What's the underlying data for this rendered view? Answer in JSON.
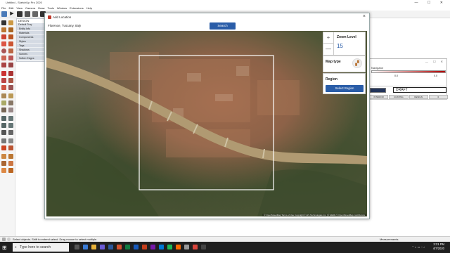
{
  "app": {
    "title": "Untitled - SketchUp Pro 2020",
    "window_controls": "— ☐ ✕"
  },
  "menu": [
    "File",
    "Edit",
    "View",
    "Camera",
    "Draw",
    "Tools",
    "Window",
    "Extensions",
    "Help"
  ],
  "tray": {
    "title": "Default Tray",
    "header_label": "DESIGN",
    "items": [
      "Entity Info",
      "Materials",
      "Components",
      "Styles",
      "Tags",
      "Shadows",
      "Scenes",
      "Soften Edges"
    ]
  },
  "dialog": {
    "title": "Add Location",
    "close": "×",
    "search": {
      "value": "Florence, Tuscany, Italy",
      "button": "Search"
    },
    "zoom": {
      "label": "Zoom Level",
      "value": "15",
      "plus": "+",
      "minus": "—"
    },
    "map_type": {
      "label": "Map type"
    },
    "region": {
      "label": "Region",
      "button": "Select Region"
    },
    "attribution": "© OpenStreetMap  Terms of Use  Copyright © AIS Technologies Inc. (© HERE © OpenStreetMap contributors"
  },
  "right_panel": {
    "title": "Navigator",
    "values": [
      "0.0",
      "0.0"
    ],
    "style_field": "DRAFT",
    "style_tabs": [
      "INTERIOR",
      "COATING",
      "DESIGN",
      "0"
    ],
    "gradient_colors": [
      "#ffffff",
      "#b20000"
    ]
  },
  "status": {
    "message": "Select objects. Shift to extend select. Drag mouse to select multiple.",
    "measurements_label": "Measurements"
  },
  "taskbar": {
    "search_placeholder": "Type here to search",
    "time": "3:31 PM",
    "date": "4/7/2020"
  },
  "colors": {
    "accent": "#2a5da8",
    "river": "#b09a72"
  }
}
